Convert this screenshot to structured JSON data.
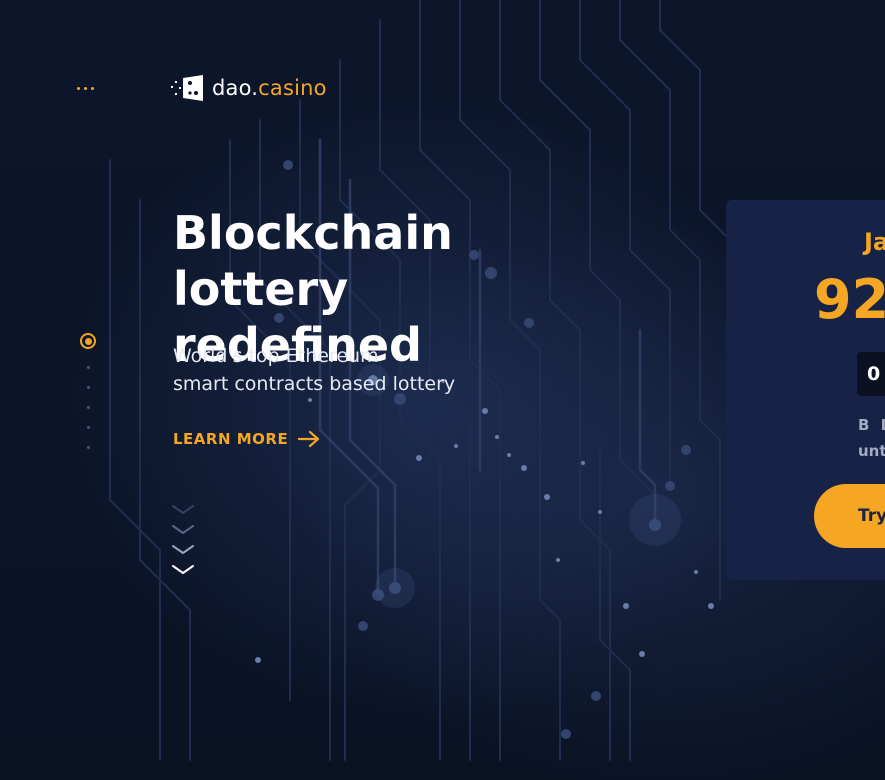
{
  "header": {
    "menu_icon": "dots-menu-icon",
    "logo": {
      "icon": "dao-casino-logo-icon",
      "name_main": "dao.",
      "name_accent": "casino"
    }
  },
  "hero": {
    "title": "Blockchain lottery\nredefined",
    "subtitle": "World's top Ethereum\nsmart contracts based lottery",
    "learn_more": "LEARN MORE"
  },
  "jackpot_card": {
    "title": "Ja",
    "amount": "92",
    "counter": "0",
    "note_line1": "B L",
    "note_line2": "unt",
    "button": "Try"
  },
  "colors": {
    "accent": "#f5a623",
    "background": "#0b1427",
    "card": "#162347",
    "text": "#ffffff"
  }
}
